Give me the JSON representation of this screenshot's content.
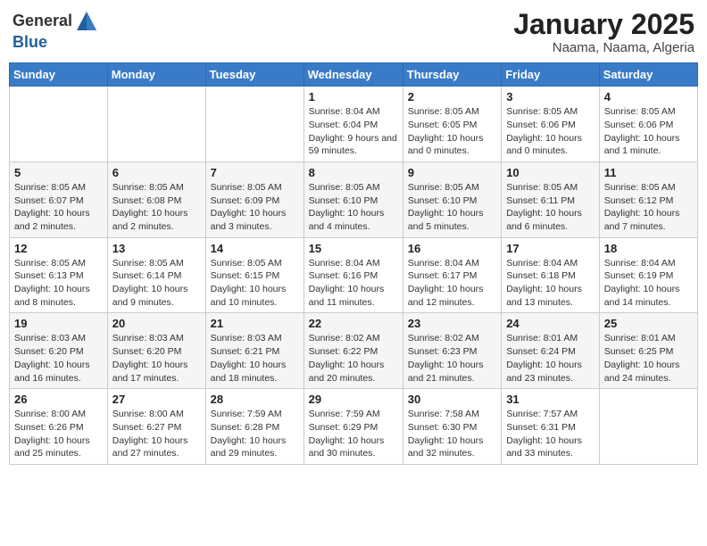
{
  "header": {
    "logo_line1": "General",
    "logo_line2": "Blue",
    "month": "January 2025",
    "location": "Naama, Naama, Algeria"
  },
  "weekdays": [
    "Sunday",
    "Monday",
    "Tuesday",
    "Wednesday",
    "Thursday",
    "Friday",
    "Saturday"
  ],
  "weeks": [
    [
      {
        "day": "",
        "info": ""
      },
      {
        "day": "",
        "info": ""
      },
      {
        "day": "",
        "info": ""
      },
      {
        "day": "1",
        "info": "Sunrise: 8:04 AM\nSunset: 6:04 PM\nDaylight: 9 hours and 59 minutes."
      },
      {
        "day": "2",
        "info": "Sunrise: 8:05 AM\nSunset: 6:05 PM\nDaylight: 10 hours and 0 minutes."
      },
      {
        "day": "3",
        "info": "Sunrise: 8:05 AM\nSunset: 6:06 PM\nDaylight: 10 hours and 0 minutes."
      },
      {
        "day": "4",
        "info": "Sunrise: 8:05 AM\nSunset: 6:06 PM\nDaylight: 10 hours and 1 minute."
      }
    ],
    [
      {
        "day": "5",
        "info": "Sunrise: 8:05 AM\nSunset: 6:07 PM\nDaylight: 10 hours and 2 minutes."
      },
      {
        "day": "6",
        "info": "Sunrise: 8:05 AM\nSunset: 6:08 PM\nDaylight: 10 hours and 2 minutes."
      },
      {
        "day": "7",
        "info": "Sunrise: 8:05 AM\nSunset: 6:09 PM\nDaylight: 10 hours and 3 minutes."
      },
      {
        "day": "8",
        "info": "Sunrise: 8:05 AM\nSunset: 6:10 PM\nDaylight: 10 hours and 4 minutes."
      },
      {
        "day": "9",
        "info": "Sunrise: 8:05 AM\nSunset: 6:10 PM\nDaylight: 10 hours and 5 minutes."
      },
      {
        "day": "10",
        "info": "Sunrise: 8:05 AM\nSunset: 6:11 PM\nDaylight: 10 hours and 6 minutes."
      },
      {
        "day": "11",
        "info": "Sunrise: 8:05 AM\nSunset: 6:12 PM\nDaylight: 10 hours and 7 minutes."
      }
    ],
    [
      {
        "day": "12",
        "info": "Sunrise: 8:05 AM\nSunset: 6:13 PM\nDaylight: 10 hours and 8 minutes."
      },
      {
        "day": "13",
        "info": "Sunrise: 8:05 AM\nSunset: 6:14 PM\nDaylight: 10 hours and 9 minutes."
      },
      {
        "day": "14",
        "info": "Sunrise: 8:05 AM\nSunset: 6:15 PM\nDaylight: 10 hours and 10 minutes."
      },
      {
        "day": "15",
        "info": "Sunrise: 8:04 AM\nSunset: 6:16 PM\nDaylight: 10 hours and 11 minutes."
      },
      {
        "day": "16",
        "info": "Sunrise: 8:04 AM\nSunset: 6:17 PM\nDaylight: 10 hours and 12 minutes."
      },
      {
        "day": "17",
        "info": "Sunrise: 8:04 AM\nSunset: 6:18 PM\nDaylight: 10 hours and 13 minutes."
      },
      {
        "day": "18",
        "info": "Sunrise: 8:04 AM\nSunset: 6:19 PM\nDaylight: 10 hours and 14 minutes."
      }
    ],
    [
      {
        "day": "19",
        "info": "Sunrise: 8:03 AM\nSunset: 6:20 PM\nDaylight: 10 hours and 16 minutes."
      },
      {
        "day": "20",
        "info": "Sunrise: 8:03 AM\nSunset: 6:20 PM\nDaylight: 10 hours and 17 minutes."
      },
      {
        "day": "21",
        "info": "Sunrise: 8:03 AM\nSunset: 6:21 PM\nDaylight: 10 hours and 18 minutes."
      },
      {
        "day": "22",
        "info": "Sunrise: 8:02 AM\nSunset: 6:22 PM\nDaylight: 10 hours and 20 minutes."
      },
      {
        "day": "23",
        "info": "Sunrise: 8:02 AM\nSunset: 6:23 PM\nDaylight: 10 hours and 21 minutes."
      },
      {
        "day": "24",
        "info": "Sunrise: 8:01 AM\nSunset: 6:24 PM\nDaylight: 10 hours and 23 minutes."
      },
      {
        "day": "25",
        "info": "Sunrise: 8:01 AM\nSunset: 6:25 PM\nDaylight: 10 hours and 24 minutes."
      }
    ],
    [
      {
        "day": "26",
        "info": "Sunrise: 8:00 AM\nSunset: 6:26 PM\nDaylight: 10 hours and 25 minutes."
      },
      {
        "day": "27",
        "info": "Sunrise: 8:00 AM\nSunset: 6:27 PM\nDaylight: 10 hours and 27 minutes."
      },
      {
        "day": "28",
        "info": "Sunrise: 7:59 AM\nSunset: 6:28 PM\nDaylight: 10 hours and 29 minutes."
      },
      {
        "day": "29",
        "info": "Sunrise: 7:59 AM\nSunset: 6:29 PM\nDaylight: 10 hours and 30 minutes."
      },
      {
        "day": "30",
        "info": "Sunrise: 7:58 AM\nSunset: 6:30 PM\nDaylight: 10 hours and 32 minutes."
      },
      {
        "day": "31",
        "info": "Sunrise: 7:57 AM\nSunset: 6:31 PM\nDaylight: 10 hours and 33 minutes."
      },
      {
        "day": "",
        "info": ""
      }
    ]
  ]
}
